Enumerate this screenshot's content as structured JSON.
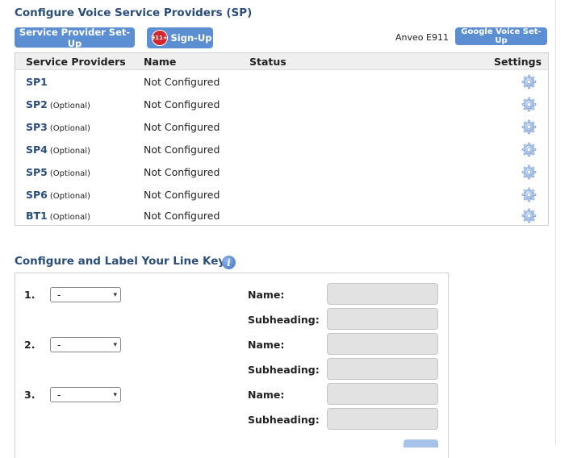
{
  "providers_section": {
    "title": "Configure Voice Service Providers (SP)",
    "setup_button": "Service Provider Set-Up",
    "signup_badge": "911+",
    "signup_button": "Sign-Up",
    "anveo_label": "Anveo E911",
    "google_button": "Google Voice Set-Up",
    "columns": {
      "providers": "Service Providers",
      "name": "Name",
      "status": "Status",
      "settings": "Settings"
    },
    "rows": [
      {
        "id": "SP1",
        "optional": "",
        "name": "Not Configured",
        "status": "",
        "settings_icon": "gear-icon"
      },
      {
        "id": "SP2",
        "optional": "(Optional)",
        "name": "Not Configured",
        "status": "",
        "settings_icon": "gear-icon"
      },
      {
        "id": "SP3",
        "optional": "(Optional)",
        "name": "Not Configured",
        "status": "",
        "settings_icon": "gear-icon"
      },
      {
        "id": "SP4",
        "optional": "(Optional)",
        "name": "Not Configured",
        "status": "",
        "settings_icon": "gear-icon"
      },
      {
        "id": "SP5",
        "optional": "(Optional)",
        "name": "Not Configured",
        "status": "",
        "settings_icon": "gear-icon"
      },
      {
        "id": "SP6",
        "optional": "(Optional)",
        "name": "Not Configured",
        "status": "",
        "settings_icon": "gear-icon"
      },
      {
        "id": "BT1",
        "optional": "(Optional)",
        "name": "Not Configured",
        "status": "",
        "settings_icon": "gear-icon"
      }
    ]
  },
  "line_keys_section": {
    "title": "Configure and Label Your Line Keys",
    "info_icon": "i",
    "keys": [
      {
        "number": "1.",
        "selected": "-",
        "name_label": "Name:",
        "name_value": "",
        "subheading_label": "Subheading:",
        "subheading_value": ""
      },
      {
        "number": "2.",
        "selected": "-",
        "name_label": "Name:",
        "name_value": "",
        "subheading_label": "Subheading:",
        "subheading_value": ""
      },
      {
        "number": "3.",
        "selected": "-",
        "name_label": "Name:",
        "name_value": "",
        "subheading_label": "Subheading:",
        "subheading_value": ""
      }
    ]
  },
  "colors": {
    "accent": "#5b8fd2",
    "title": "#2a4d7a",
    "badge": "#d4262c",
    "input_bg": "#e2e2e2"
  }
}
